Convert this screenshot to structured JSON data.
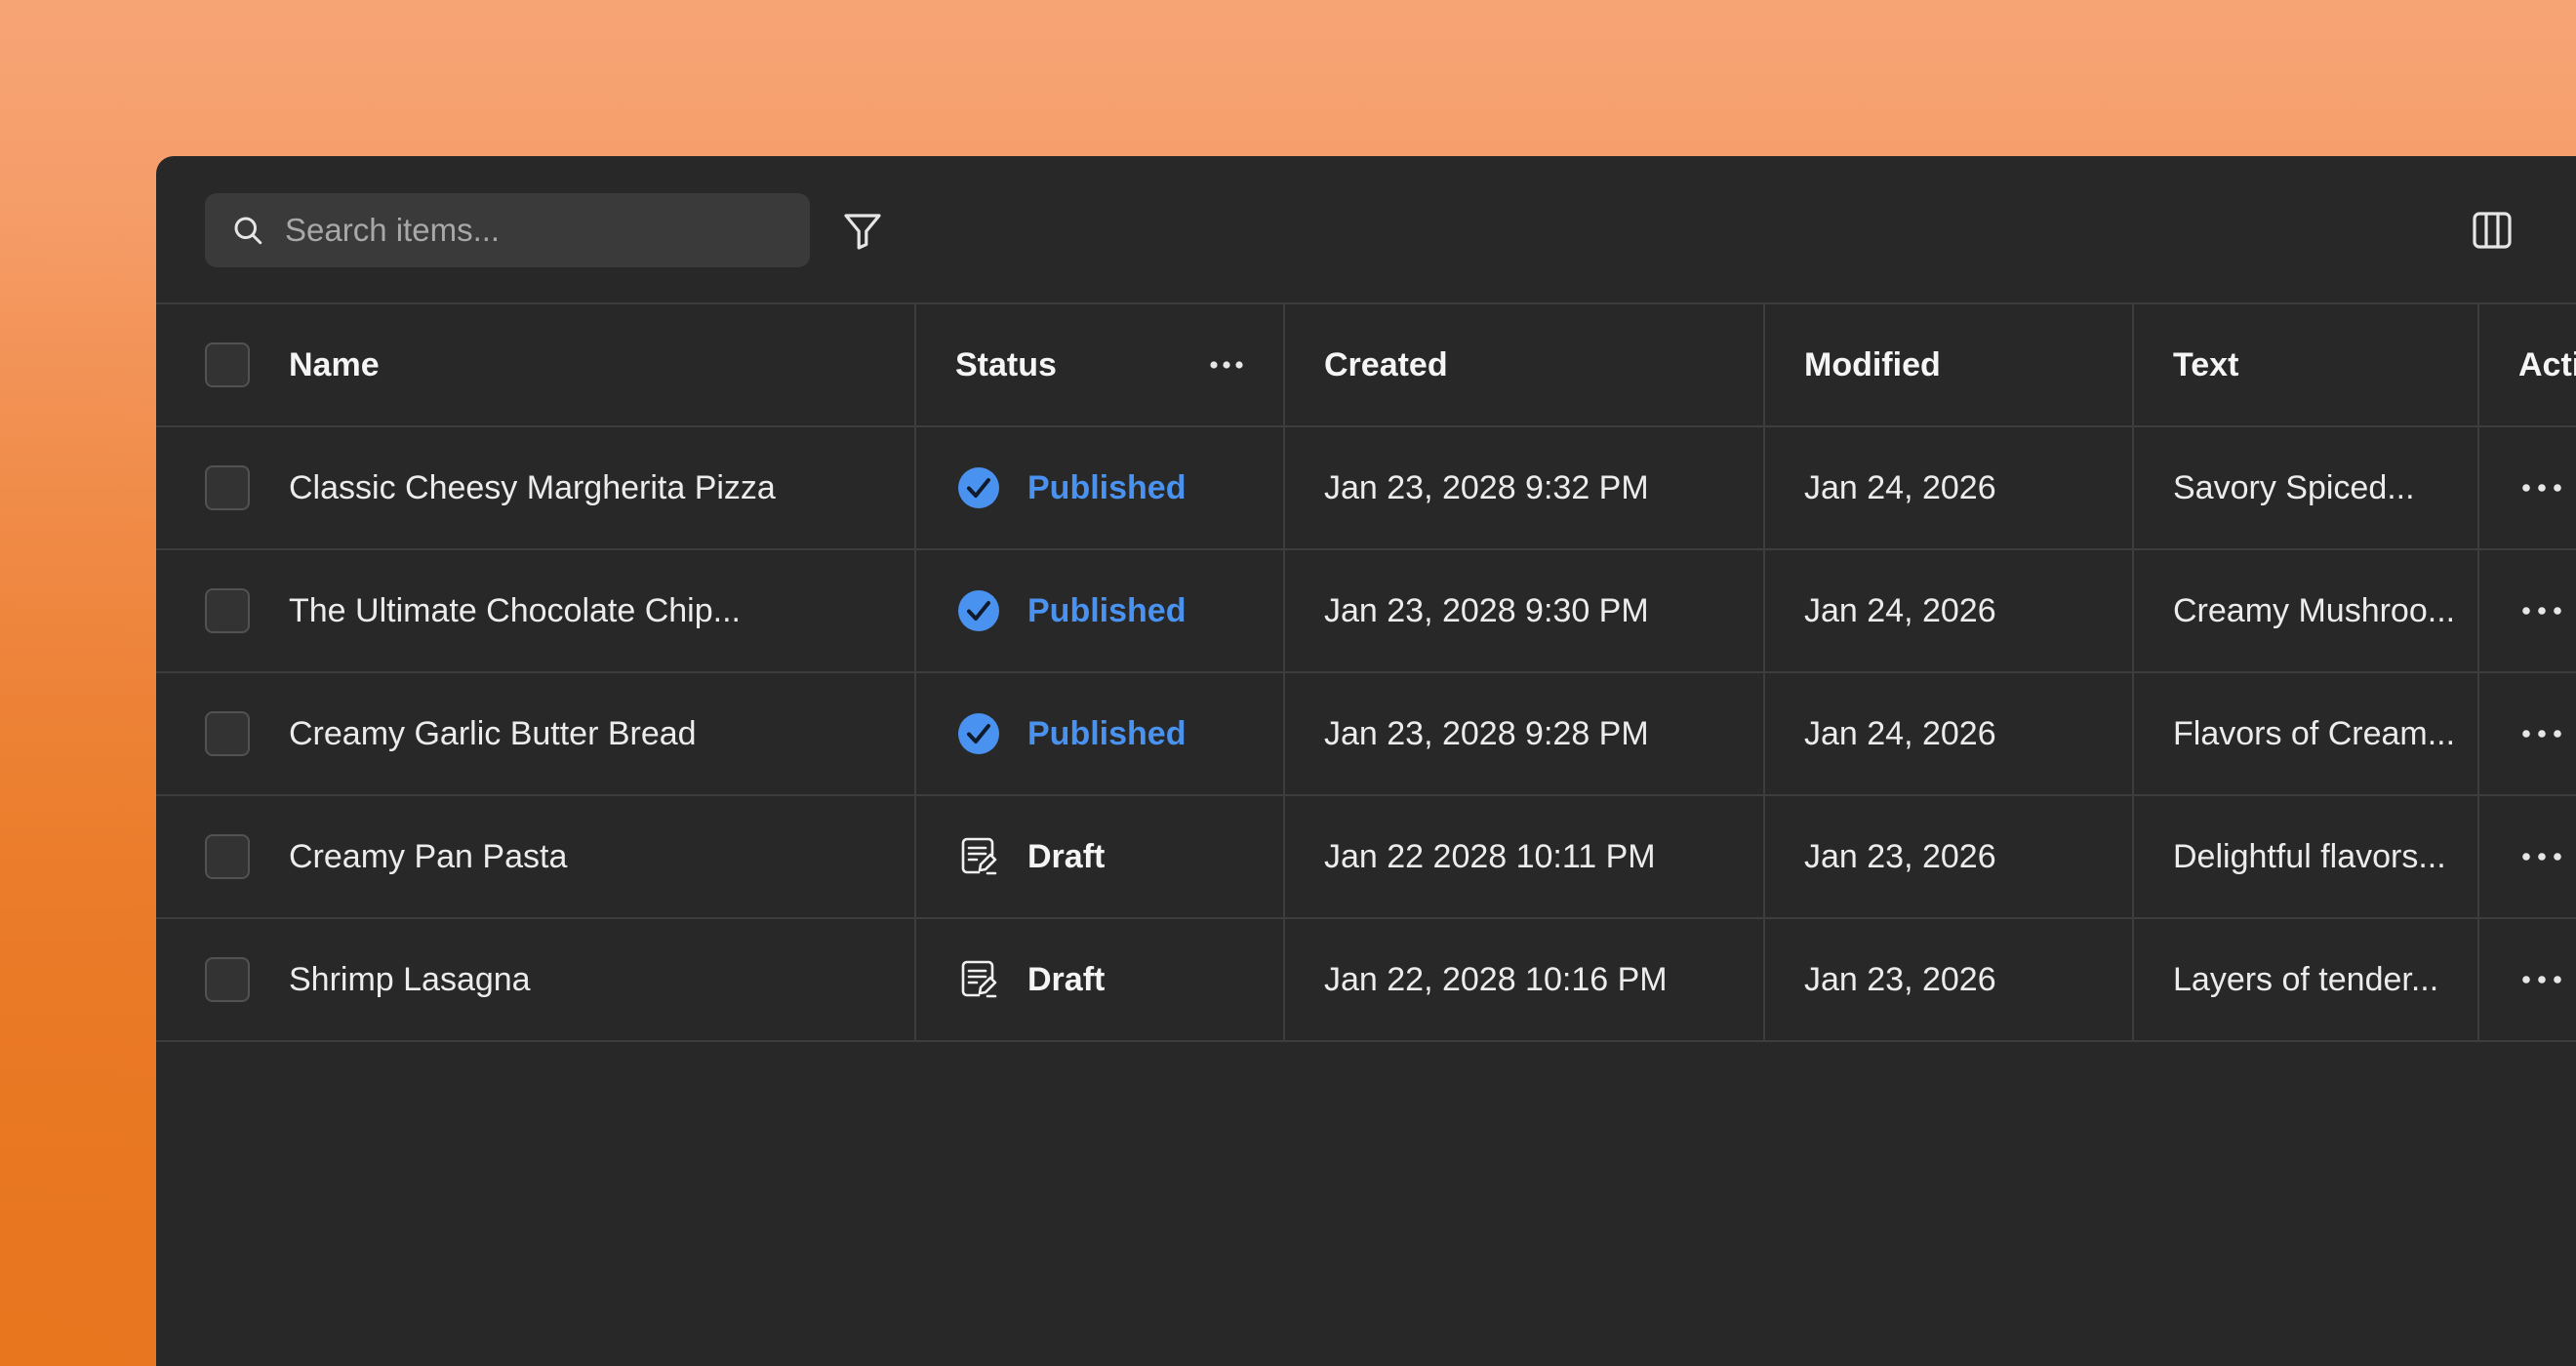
{
  "search": {
    "placeholder": "Search items..."
  },
  "toolbar": {
    "filter_icon": "filter-icon",
    "columns_icon": "columns-icon"
  },
  "table": {
    "headers": {
      "name": "Name",
      "status": "Status",
      "created": "Created",
      "modified": "Modified",
      "text": "Text",
      "actions": "Actions"
    },
    "rows": [
      {
        "name": "Classic Cheesy Margherita Pizza",
        "status": "Published",
        "created": "Jan 23, 2028 9:32 PM",
        "modified": "Jan 24, 2026",
        "text": "Savory Spiced..."
      },
      {
        "name": "The Ultimate Chocolate Chip...",
        "status": "Published",
        "created": "Jan 23, 2028 9:30 PM",
        "modified": "Jan 24, 2026",
        "text": "Creamy Mushroo..."
      },
      {
        "name": "Creamy Garlic Butter Bread",
        "status": "Published",
        "created": "Jan 23, 2028 9:28 PM",
        "modified": "Jan 24, 2026",
        "text": "Flavors of Cream..."
      },
      {
        "name": "Creamy Pan Pasta",
        "status": "Draft",
        "created": "Jan 22 2028 10:11 PM",
        "modified": "Jan 23, 2026",
        "text": "Delightful flavors..."
      },
      {
        "name": "Shrimp Lasagna",
        "status": "Draft",
        "created": "Jan 22, 2028 10:16 PM",
        "modified": "Jan 23, 2026",
        "text": "Layers of tender..."
      }
    ]
  },
  "colors": {
    "published": "#4a92f0",
    "panel_bg": "#282828",
    "background_top": "#f7a475",
    "background_bottom": "#ea7625"
  }
}
